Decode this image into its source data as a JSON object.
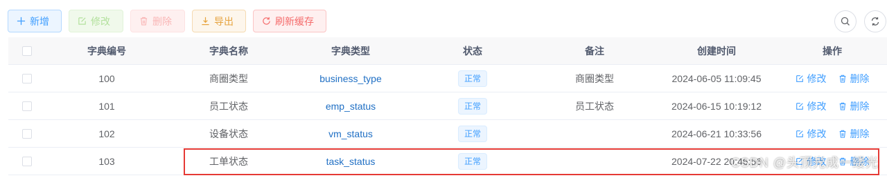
{
  "toolbar": {
    "add_label": "新增",
    "edit_label": "修改",
    "delete_label": "删除",
    "export_label": "导出",
    "refresh_label": "刷新缓存"
  },
  "table": {
    "headers": {
      "code": "字典编号",
      "name": "字典名称",
      "type": "字典类型",
      "status": "状态",
      "remark": "备注",
      "created": "创建时间",
      "ops": "操作"
    },
    "rows": [
      {
        "code": "100",
        "name": "商圈类型",
        "type": "business_type",
        "status": "正常",
        "remark": "商圈类型",
        "created": "2024-06-05 11:09:45",
        "edit": "修改",
        "delete": "删除"
      },
      {
        "code": "101",
        "name": "员工状态",
        "type": "emp_status",
        "status": "正常",
        "remark": "员工状态",
        "created": "2024-06-15 10:19:12",
        "edit": "修改",
        "delete": "删除"
      },
      {
        "code": "102",
        "name": "设备状态",
        "type": "vm_status",
        "status": "正常",
        "remark": "",
        "created": "2024-06-21 10:33:56",
        "edit": "修改",
        "delete": "删除"
      },
      {
        "code": "103",
        "name": "工单状态",
        "type": "task_status",
        "status": "正常",
        "remark": "",
        "created": "2024-07-22 20:46:56",
        "edit": "修改",
        "delete": "删除"
      }
    ]
  },
  "watermark": "CSDN @头顶光成一缕光",
  "colors": {
    "primary": "#409eff",
    "success_light": "#b3e19d",
    "danger_light": "#f9b6b6",
    "warning": "#e6a23c",
    "danger": "#f56c6c",
    "highlight_border": "#e53935"
  },
  "icons": [
    "plus-icon",
    "edit-icon",
    "trash-icon",
    "download-icon",
    "refresh-icon",
    "search-icon",
    "sync-icon",
    "checkbox"
  ]
}
